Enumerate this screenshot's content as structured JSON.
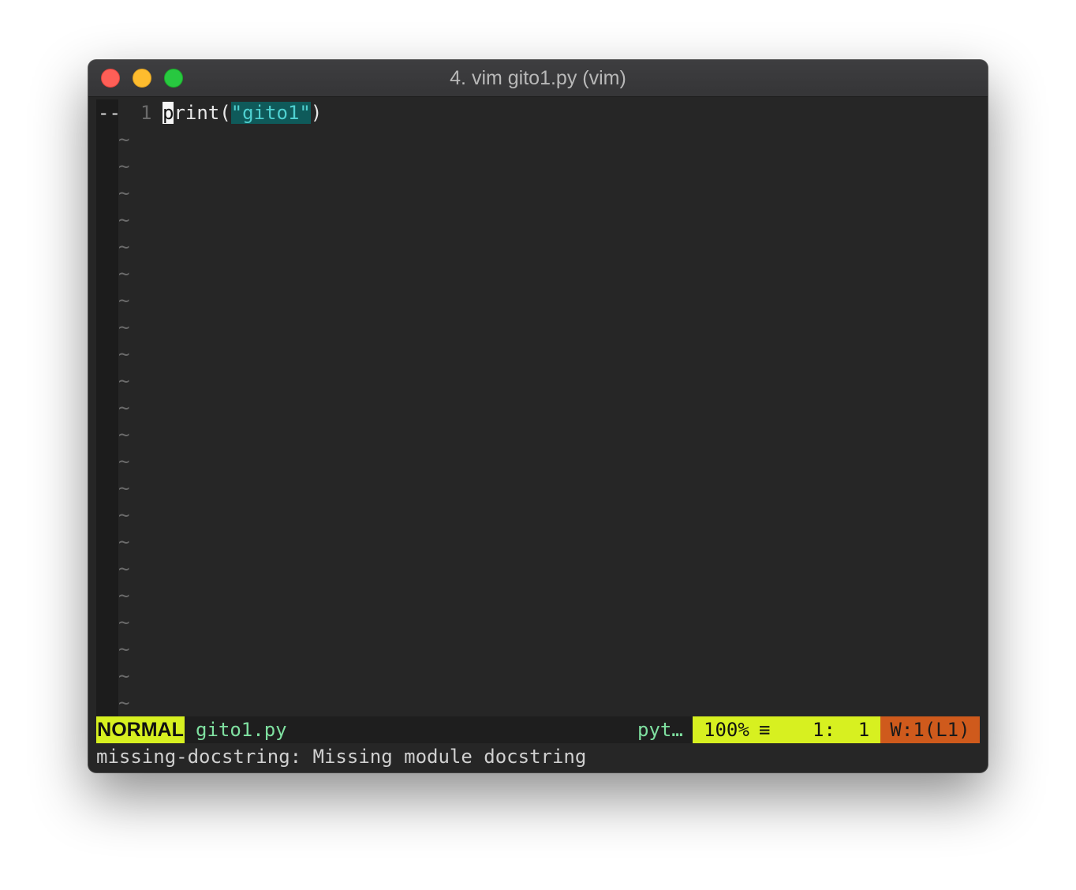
{
  "window": {
    "title": "4. vim gito1.py (vim)"
  },
  "editor": {
    "sign_column": "--",
    "line_number": "1",
    "code": {
      "cursor_char": "p",
      "before_string": "rint(",
      "string_literal": "\"gito1\"",
      "after_string": ")"
    },
    "empty_line_marker": "~",
    "empty_line_count": 22
  },
  "statusline": {
    "mode": "NORMAL",
    "filename": "gito1.py",
    "filetype": "pyt…",
    "percent": "100%",
    "menu_glyph": "≡",
    "line_col": "1:  1",
    "warnings": "W:1(L1)"
  },
  "message": "missing-docstring: Missing module docstring",
  "colors": {
    "mode_bg": "#d7f020",
    "warning_bg": "#cf5a1c",
    "string_fg": "#4fd0d0",
    "string_bg": "#0f5a5a",
    "filename_fg": "#7fe0a0",
    "background": "#262626"
  }
}
